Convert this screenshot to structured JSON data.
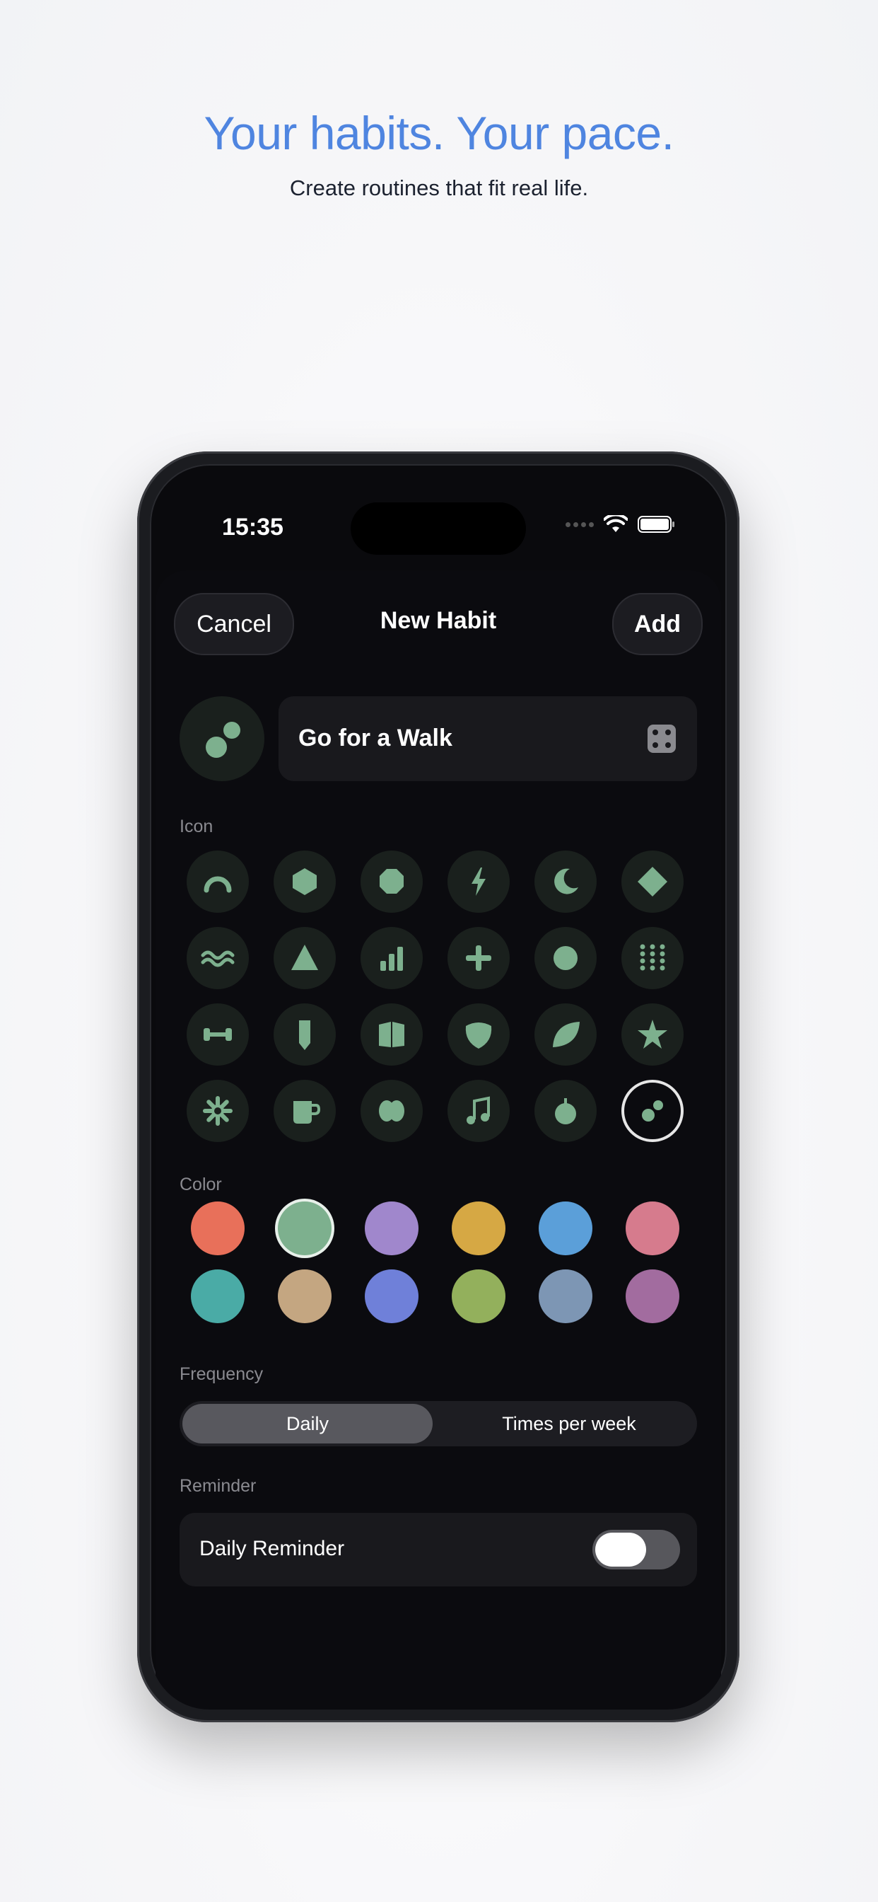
{
  "hero": {
    "title": "Your habits. Your pace.",
    "subtitle": "Create routines that fit real life."
  },
  "status_bar": {
    "time": "15:35"
  },
  "nav": {
    "cancel_label": "Cancel",
    "title": "New Habit",
    "add_label": "Add"
  },
  "habit": {
    "name": "Go for a Walk",
    "selected_icon": "walk-dots-icon"
  },
  "icon_section": {
    "label": "Icon",
    "icons": [
      "arc-icon",
      "hexagon-icon",
      "octagon-icon",
      "bolt-icon",
      "moon-icon",
      "diamond-icon",
      "waves-icon",
      "triangle-icon",
      "bars-chart-icon",
      "plus-icon",
      "circle-icon",
      "dot-grid-icon",
      "dumbbell-icon",
      "bookmark-icon",
      "book-icon",
      "heart-icon",
      "leaf-icon",
      "star-icon",
      "sun-icon",
      "cup-icon",
      "pill-icon",
      "music-note-icon",
      "apple-icon",
      "walk-dots-icon"
    ],
    "accent_color": "#7db08e"
  },
  "color_section": {
    "label": "Color",
    "colors": [
      "#e8705a",
      "#7db08e",
      "#a087cc",
      "#d6a844",
      "#5b9fd9",
      "#d67b8d",
      "#4aaba6",
      "#c4a681",
      "#6f80d9",
      "#93b05c",
      "#7d96b4",
      "#a26c9f"
    ],
    "selected_color": "#7db08e"
  },
  "frequency": {
    "label": "Frequency",
    "options": [
      "Daily",
      "Times per week"
    ],
    "selected": "Daily"
  },
  "reminder": {
    "label": "Reminder",
    "row_label": "Daily Reminder",
    "enabled": false
  }
}
